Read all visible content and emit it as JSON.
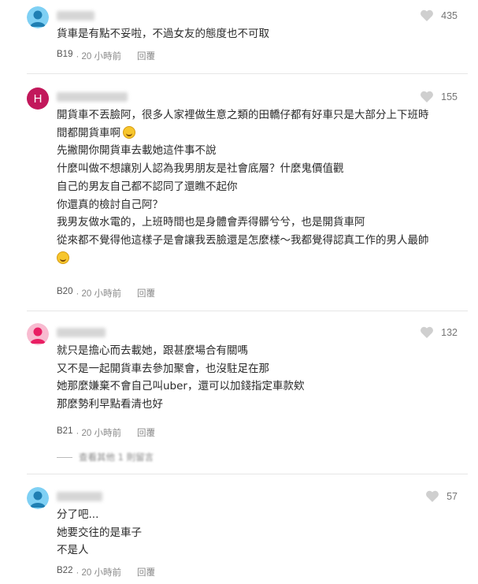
{
  "comments": [
    {
      "avatar_type": "person",
      "avatar_color": "#7fd0f4",
      "likes": "435",
      "lines": [
        "貨車是有點不妥啦，不過女友的態度也不可取"
      ],
      "floor": "B19",
      "time": "· 20 小時前",
      "reply": "回覆"
    },
    {
      "avatar_type": "letter",
      "avatar_letter": "H",
      "avatar_color": "#c2185b",
      "likes": "155",
      "lines": [
        "開貨車不丟臉阿，很多人家裡做生意之類的田轎仔都有好車只是大部分上下班時",
        "間都開貨車啊",
        "先撇開你開貨車去載她這件事不說",
        "什麼叫做不想讓別人認為我男朋友是社會底層？什麼鬼價值觀",
        "自己的男友自己都不認同了還瞧不起你",
        "你還真的檢討自己阿？",
        "我男友做水電的，上班時間也是身體會弄得髒兮兮，也是開貨車阿",
        "從來都不覺得他這樣子是會讓我丟臉還是怎麼樣～我都覺得認真工作的男人最帥",
        ""
      ],
      "floor": "B20",
      "time": "· 20 小時前",
      "reply": "回覆"
    },
    {
      "avatar_type": "person",
      "avatar_color": "#f48fb1",
      "likes": "132",
      "lines": [
        "就只是擔心而去載她，跟甚麼場合有關嗎",
        "又不是一起開貨車去參加聚會，也沒駐足在那",
        "她那麼嫌棄不會自己叫uber，還可以加錢指定車款欸",
        "那麼勢利早點看清也好"
      ],
      "floor": "B21",
      "time": "· 20 小時前",
      "reply": "回覆",
      "more_replies": "查看其他 1 則留言"
    },
    {
      "avatar_type": "person",
      "avatar_color": "#7fd0f4",
      "likes": "57",
      "lines": [
        "分了吧...",
        "她要交往的是車子",
        "不是人"
      ],
      "floor": "B22",
      "time": "· 20 小時前",
      "reply": "回覆"
    }
  ]
}
